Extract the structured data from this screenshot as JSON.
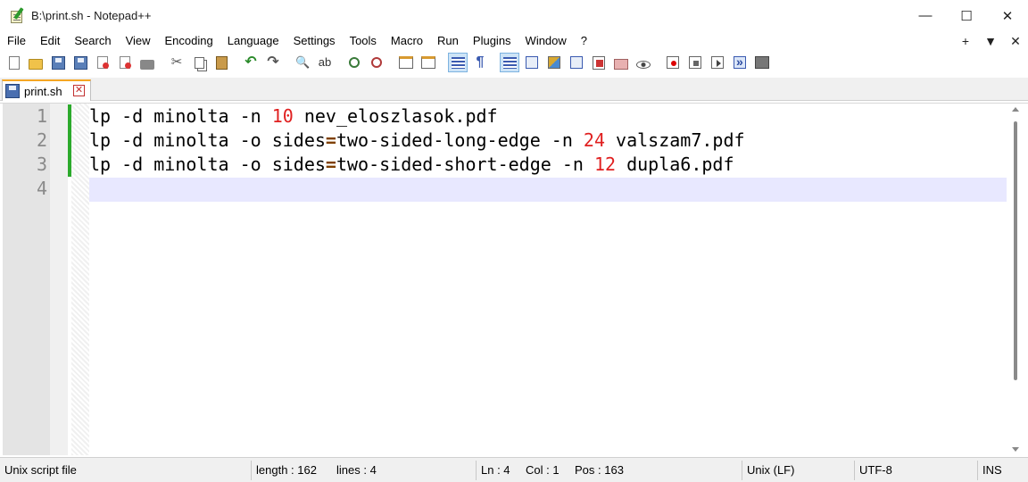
{
  "window": {
    "title": "B:\\print.sh - Notepad++",
    "minimize": "—",
    "maximize": "☐",
    "close": "✕"
  },
  "menu": {
    "items": [
      "File",
      "Edit",
      "Search",
      "View",
      "Encoding",
      "Language",
      "Settings",
      "Tools",
      "Macro",
      "Run",
      "Plugins",
      "Window",
      "?"
    ],
    "right": {
      "add": "+",
      "dropdown": "▼",
      "close": "✕"
    }
  },
  "toolbar": {
    "icons": [
      "new-file-icon",
      "open-folder-icon",
      "save-icon",
      "save-all-icon",
      "close-icon",
      "close-all-icon",
      "print-icon",
      "cut-icon",
      "copy-icon",
      "paste-icon",
      "undo-icon",
      "redo-icon",
      "find-icon",
      "replace-icon",
      "zoom-in-icon",
      "zoom-out-icon",
      "sync-vertical-icon",
      "sync-horizontal-icon",
      "word-wrap-icon",
      "show-all-characters-icon",
      "indent-guide-icon",
      "user-language-icon",
      "doc-map-icon",
      "doc-list-icon",
      "function-list-icon",
      "folder-workspace-icon",
      "monitoring-icon",
      "record-macro-icon",
      "stop-recording-icon",
      "playback-icon",
      "run-macro-multiple-icon",
      "save-macro-icon"
    ],
    "find_glyph": "🔍",
    "replace_glyph": "ab",
    "undo_glyph": "↶",
    "redo_glyph": "↷",
    "para_glyph": "¶",
    "cut_glyph": "✂"
  },
  "tabs": [
    {
      "label": "print.sh",
      "close": "✕"
    }
  ],
  "editor": {
    "line_numbers": [
      "1",
      "2",
      "3",
      "4"
    ],
    "lines": [
      {
        "pre": "lp -d minolta -n ",
        "num": "10",
        "post": " nev_eloszlasok.pdf"
      },
      {
        "pre": "lp -d minolta -o sides",
        "op": "=",
        "mid": "two-sided-long-edge -n ",
        "num": "24",
        "post": " valszam7.pdf"
      },
      {
        "pre": "lp -d minolta -o sides",
        "op": "=",
        "mid": "two-sided-short-edge -n ",
        "num": "12",
        "post": " dupla6.pdf"
      }
    ]
  },
  "status": {
    "type": "Unix script file",
    "length": "length : 162",
    "lines": "lines : 4",
    "ln": "Ln : 4",
    "col": "Col : 1",
    "pos": "Pos : 163",
    "eol": "Unix (LF)",
    "encoding": "UTF-8",
    "mode": "INS"
  }
}
